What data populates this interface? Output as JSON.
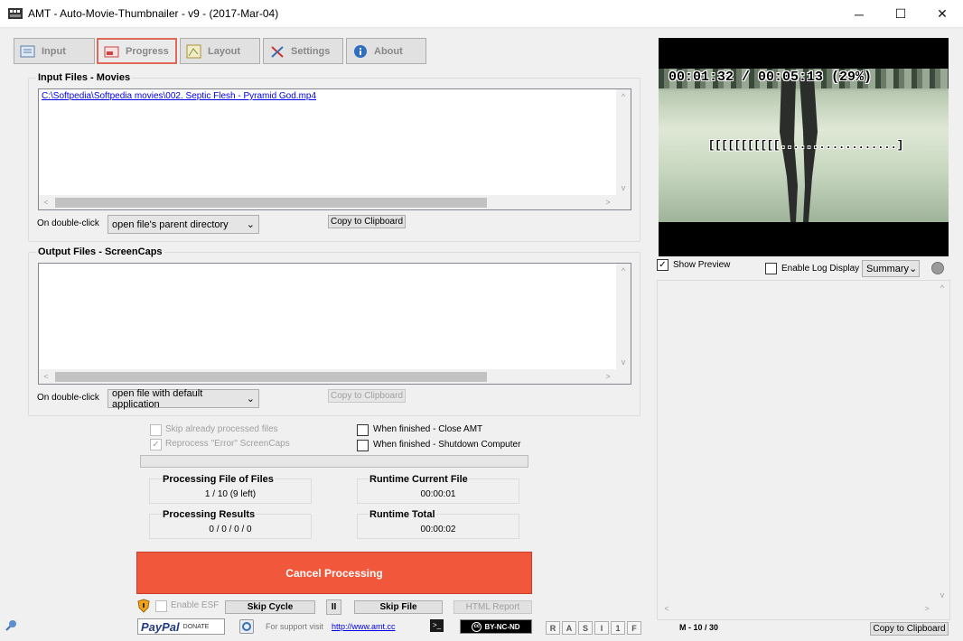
{
  "window": {
    "title": "AMT - Auto-Movie-Thumbnailer - v9 - (2017-Mar-04)",
    "minimize": "─",
    "maximize": "☐",
    "close": "✕"
  },
  "tabs": [
    {
      "label": "Input"
    },
    {
      "label": "Progress"
    },
    {
      "label": "Layout"
    },
    {
      "label": "Settings"
    },
    {
      "label": "About"
    }
  ],
  "input": {
    "group_label": "Input Files - Movies",
    "files": [
      "C:\\Softpedia\\Softpedia movies\\002. Septic Flesh - Pyramid God.mp4"
    ],
    "double_click_label": "On double-click",
    "double_click_value": "open file's parent directory",
    "copy_label": "Copy to Clipboard"
  },
  "output": {
    "group_label": "Output Files - ScreenCaps",
    "double_click_label": "On double-click",
    "double_click_value": "open file with default application",
    "copy_label": "Copy to Clipboard"
  },
  "options": {
    "skip_processed": "Skip already processed files",
    "reprocess_error": "Reprocess \"Error\" ScreenCaps",
    "close_amt": "When finished - Close AMT",
    "shutdown": "When finished - Shutdown Computer"
  },
  "stats": {
    "processing_file_title": "Processing File of Files",
    "processing_file_value": "1 / 10 (9 left)",
    "runtime_current_title": "Runtime Current File",
    "runtime_current_value": "00:00:01",
    "results_title": "Processing Results",
    "results_value": "0 / 0 / 0 / 0",
    "runtime_total_title": "Runtime Total",
    "runtime_total_value": "00:00:02"
  },
  "cancel_label": "Cancel Processing",
  "bottom": {
    "enable_esf": "Enable ESF",
    "skip_cycle": "Skip Cycle",
    "pause": "II",
    "skip_file": "Skip File",
    "html_report": "HTML Report",
    "paypal": "PayPal",
    "donate": "DONATE",
    "support_text": "For support visit",
    "support_link": "http://www.amt.cc",
    "cc_label": "BY-NC-ND",
    "letters": [
      "R",
      "A",
      "S",
      "I",
      "1",
      "F"
    ],
    "counter": "M - 10 / 30",
    "copy_label": "Copy to Clipboard"
  },
  "preview": {
    "time_text": "00:01:32 / 00:05:13 (29%)",
    "progress_text": "[[[[[[[[[[[..................]",
    "show_preview": "Show Preview",
    "enable_log": "Enable Log Display",
    "log_mode": "Summary",
    "progress_percent": 29
  },
  "colors": {
    "accent_red": "#f1573a",
    "link_blue": "#0000ee"
  }
}
